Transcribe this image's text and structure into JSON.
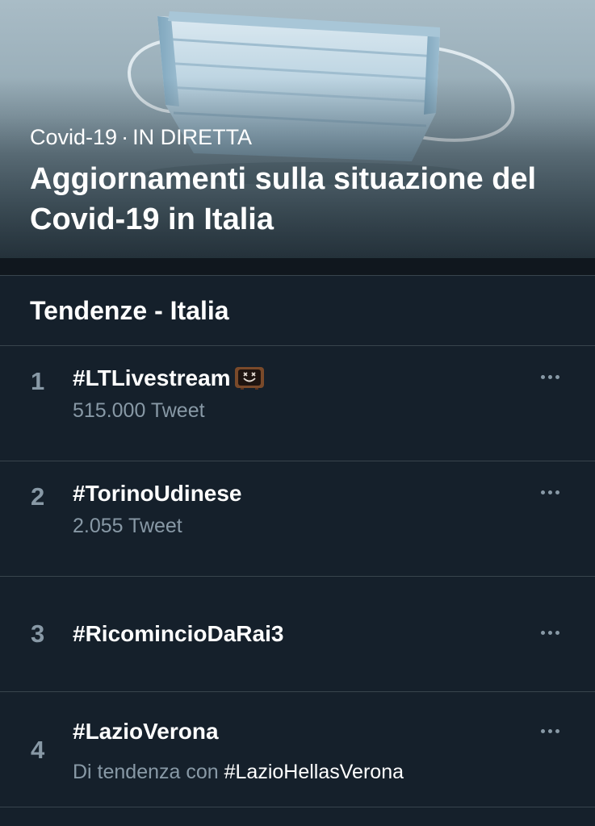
{
  "hero": {
    "kicker_topic": "Covid-19",
    "kicker_separator": "·",
    "kicker_status": "IN DIRETTA",
    "title": "Aggiornamenti sulla situazione del Covid-19 in Italia",
    "image_icon": "face-mask-photo"
  },
  "trends_section": {
    "title": "Tendenze - Italia"
  },
  "trends": [
    {
      "rank": "1",
      "name": "#LTLivestream",
      "emoji_icon": "tv-smiley-emoji-icon",
      "meta": "515.000 Tweet"
    },
    {
      "rank": "2",
      "name": "#TorinoUdinese",
      "meta": "2.055 Tweet"
    },
    {
      "rank": "3",
      "name": "#RicomincioDaRai3",
      "meta": ""
    },
    {
      "rank": "4",
      "name": "#LazioVerona",
      "meta_prefix": "Di tendenza con ",
      "meta_link": "#LazioHellasVerona"
    }
  ],
  "colors": {
    "background": "#15202b",
    "divider": "#38444d",
    "secondary_text": "#8899a6",
    "primary_text": "#ffffff"
  }
}
